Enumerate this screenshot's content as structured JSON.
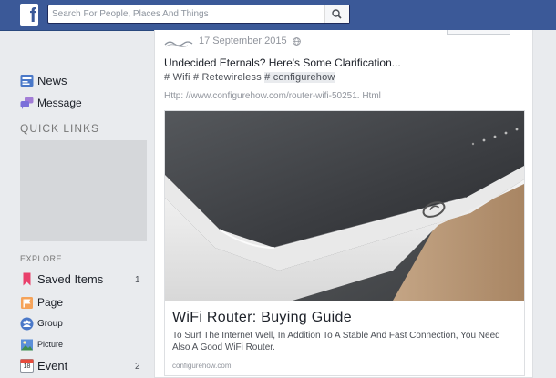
{
  "topbar": {
    "logo": "f",
    "search_placeholder": "Search For People, Places And Things"
  },
  "sidebar": {
    "items_top": [
      {
        "label": "News"
      },
      {
        "label": "Message"
      }
    ],
    "quick_links_title": "QUICK LINKS",
    "explore_title": "EXPLORE",
    "explore_items": [
      {
        "label": "Saved Items",
        "count": "1"
      },
      {
        "label": "Page",
        "count": ""
      },
      {
        "label": "Group",
        "count": ""
      },
      {
        "label": "Picture",
        "count": ""
      },
      {
        "label": "Event",
        "count": "2",
        "icon_text": "18"
      }
    ]
  },
  "post": {
    "date": "17 September 2015",
    "text": "Undecided Eternals? Here's Some Clarification...",
    "hashtags_plain": "# Wifi # Retewireless ",
    "hashtags_hl": "# configurehow",
    "url": "Http: //www.configurehow.com/router-wifi-50251. Html",
    "link": {
      "title": "WiFi Router: Buying Guide",
      "description": "To Surf The Internet Well, In Addition To A Stable And Fast Connection, You Need Also A Good WiFi Router.",
      "domain": "configurehow.com"
    }
  },
  "colors": {
    "brand": "#3b5998",
    "background": "#e9ebee",
    "saved_icon": "#e9406b",
    "page_icon": "#f5a35a",
    "group_icon": "#4a78c8"
  }
}
